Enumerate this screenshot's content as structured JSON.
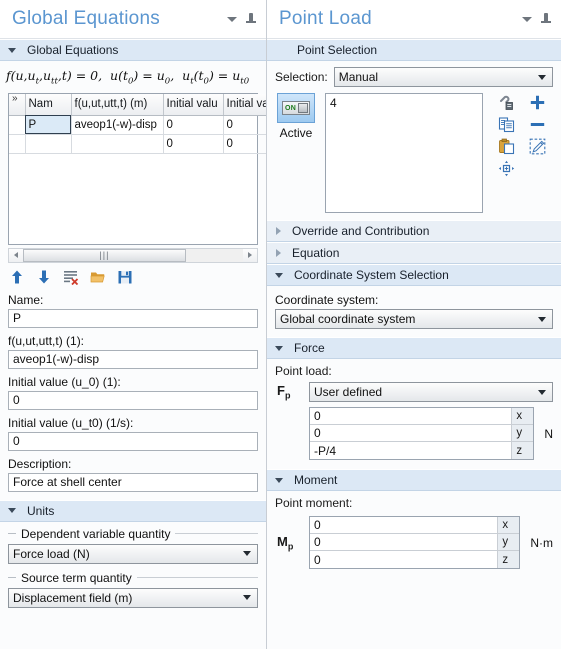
{
  "left_panel": {
    "title": "Global Equations",
    "section_global_equations": {
      "header": "Global Equations",
      "equation_text": "f(u,ut,utt,t) = 0,  u(t0) = u0,  ut(t0) = ut0",
      "table": {
        "columns": [
          "Nam",
          "f(u,ut,utt,t) (m)",
          "Initial valu",
          "Initial va"
        ],
        "rows": [
          [
            "P",
            "aveop1(-w)-disp",
            "0",
            "0"
          ],
          [
            "",
            "",
            "0",
            "0"
          ]
        ]
      },
      "toolbar": [
        {
          "name": "move-up",
          "tooltip": "Move Up"
        },
        {
          "name": "move-down",
          "tooltip": "Move Down"
        },
        {
          "name": "clear-table",
          "tooltip": "Clear Table"
        },
        {
          "name": "load-from-file",
          "tooltip": "Load from File"
        },
        {
          "name": "save-to-file",
          "tooltip": "Save to File"
        }
      ],
      "fields": [
        {
          "label": "Name:",
          "value": "P"
        },
        {
          "label": "f(u,ut,utt,t) (1):",
          "value": "aveop1(-w)-disp"
        },
        {
          "label": "Initial value (u_0) (1):",
          "value": "0"
        },
        {
          "label": "Initial value (u_t0) (1/s):",
          "value": "0"
        },
        {
          "label": "Description:",
          "value": "Force at shell center"
        }
      ]
    },
    "section_units": {
      "header": "Units",
      "group_dependent": "Dependent variable quantity",
      "dependent_value": "Force load (N)",
      "group_source": "Source term quantity",
      "source_value": "Displacement field (m)"
    }
  },
  "right_panel": {
    "title": "Point Load",
    "section_point_selection": {
      "header": "Point Selection",
      "selection_label": "Selection:",
      "selection_value": "Manual",
      "active_label": "Active",
      "toggle_state": "ON",
      "list_items": [
        "4"
      ],
      "icons": [
        "paste-link-icon",
        "copy-icon",
        "paste-icon",
        "zoom-to-selection-icon",
        "add-icon",
        "remove-icon",
        "clear-selection-icon"
      ]
    },
    "section_override": {
      "header": "Override and Contribution",
      "expanded": false
    },
    "section_equation": {
      "header": "Equation",
      "expanded": false
    },
    "section_coordinate": {
      "header": "Coordinate System Selection",
      "label": "Coordinate system:",
      "value": "Global coordinate system"
    },
    "section_force": {
      "header": "Force",
      "label": "Point load:",
      "symbol": "F",
      "symbol_sub": "p",
      "type_value": "User defined",
      "components": [
        {
          "value": "0",
          "axis": "x"
        },
        {
          "value": "0",
          "axis": "y"
        },
        {
          "value": "-P/4",
          "axis": "z"
        }
      ],
      "unit": "N"
    },
    "section_moment": {
      "header": "Moment",
      "label": "Point moment:",
      "symbol": "M",
      "symbol_sub": "p",
      "components": [
        {
          "value": "0",
          "axis": "x"
        },
        {
          "value": "0",
          "axis": "y"
        },
        {
          "value": "0",
          "axis": "z"
        }
      ],
      "unit": "N·m"
    }
  },
  "colors": {
    "title_blue": "#5b96d0",
    "section_header_bg": "#dce8f5",
    "panel_bg": "#fbfcfd",
    "selection_fill": "#dbeaf7",
    "toolbar_icon_blue": "#2c6fb5",
    "folder_orange": "#e8a33d"
  }
}
